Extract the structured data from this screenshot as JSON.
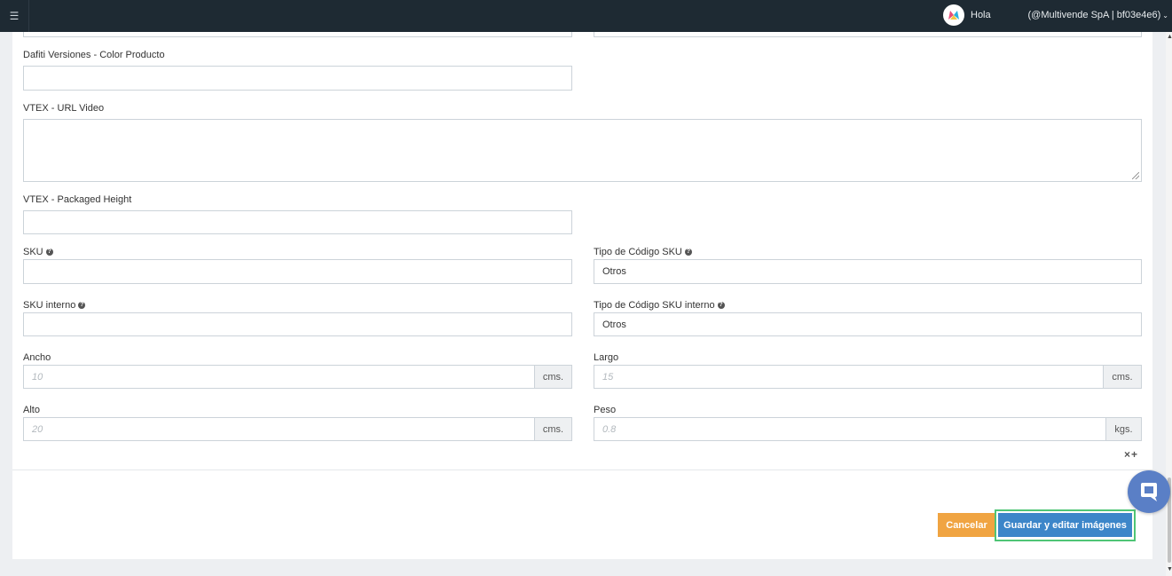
{
  "topbar": {
    "greeting": "Hola",
    "account": "(@Multivende SpA | bf03e4e6)"
  },
  "form": {
    "dafiti_color": {
      "label": "Dafiti Versiones - Color Producto",
      "value": ""
    },
    "vtex_video": {
      "label": "VTEX - URL Video",
      "value": ""
    },
    "vtex_packaged_height": {
      "label": "VTEX - Packaged Height",
      "value": ""
    },
    "sku": {
      "label": "SKU",
      "value": ""
    },
    "sku_code_type": {
      "label": "Tipo de Código SKU",
      "value": "Otros"
    },
    "sku_internal": {
      "label": "SKU interno",
      "value": ""
    },
    "sku_internal_code_type": {
      "label": "Tipo de Código SKU interno",
      "value": "Otros"
    },
    "ancho": {
      "label": "Ancho",
      "placeholder": "10",
      "unit": "cms."
    },
    "largo": {
      "label": "Largo",
      "placeholder": "15",
      "unit": "cms."
    },
    "alto": {
      "label": "Alto",
      "placeholder": "20",
      "unit": "cms."
    },
    "peso": {
      "label": "Peso",
      "placeholder": "0.8",
      "unit": "kgs."
    }
  },
  "row_actions": {
    "remove": "×",
    "add": "+"
  },
  "buttons": {
    "cancel": "Cancelar",
    "save": "Guardar y editar imágenes"
  },
  "colors": {
    "topbar": "#1e2a33",
    "cancel": "#f0a442",
    "save": "#3c86c9",
    "highlight": "#4fc576",
    "chat": "#5a7fc6"
  },
  "icons": [
    "menu-icon",
    "brand-logo-icon",
    "chevron-down-icon",
    "help-icon",
    "remove-icon",
    "add-icon",
    "chat-icon"
  ]
}
